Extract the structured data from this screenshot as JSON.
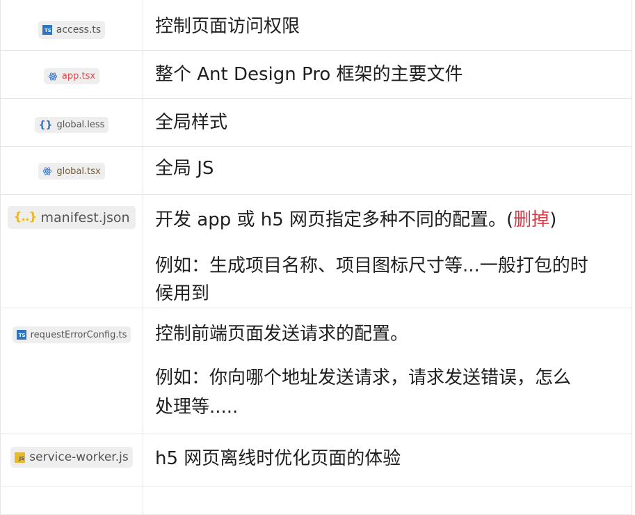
{
  "rows": [
    {
      "file": "access.ts",
      "icon": "ts-icon",
      "desc": "控制页面访问权限"
    },
    {
      "file": "app.tsx",
      "icon": "react-icon",
      "desc": "整个 Ant Design Pro 框架的主要文件"
    },
    {
      "file": "global.less",
      "icon": "braces-icon",
      "desc": "全局样式"
    },
    {
      "file": "global.tsx",
      "icon": "react-icon",
      "desc": "全局 JS"
    },
    {
      "file": "manifest.json",
      "icon": "json-icon",
      "desc_pre": "开发 app 或 h5 网页指定多种不同的配置。(",
      "desc_highlight": "删掉",
      "desc_post": ")",
      "detail_line1": "例如：生成项目名称、项目图标尺寸等...一般打包的时",
      "detail_line2": "候用到"
    },
    {
      "file": "requestErrorConfig.ts",
      "icon": "ts-icon",
      "desc": "控制前端页面发送请求的配置。",
      "detail_line1": "例如：你向哪个地址发送请求，请求发送错误，怎么",
      "detail_line2": "处理等....."
    },
    {
      "file": "service-worker.js",
      "icon": "js-icon",
      "desc": "h5 网页离线时优化页面的体验"
    }
  ],
  "icons": {
    "ts_label": "TS",
    "js_label": "JS",
    "braces": "{}",
    "json_braces": "{..}"
  },
  "colors": {
    "highlight": "#d73a49",
    "ts": "#2f74c0",
    "js": "#e8b82f",
    "react": "#3b7bd4",
    "chip_bg": "#eeeeee"
  }
}
